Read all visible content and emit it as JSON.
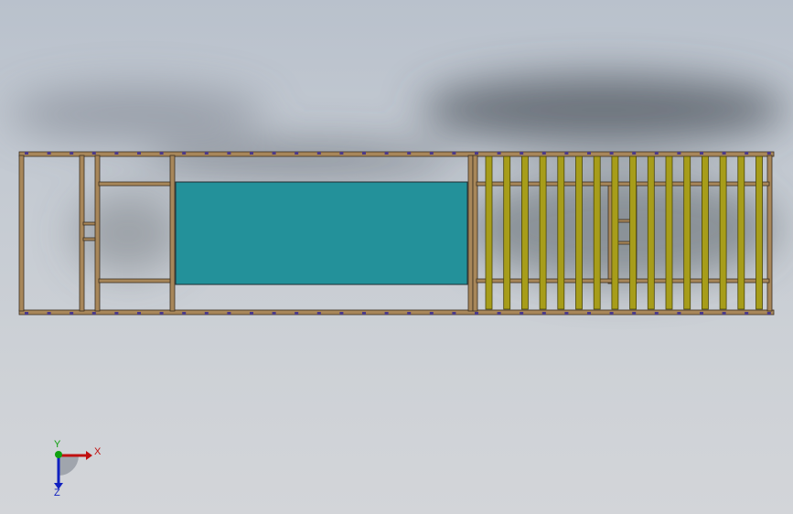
{
  "viewport": {
    "background_top": "#b9c1cc",
    "background_bottom": "#d3d5d9"
  },
  "model": {
    "frame_color": "#a8875a",
    "frame_edge_color": "#3a2e20",
    "bolt_color": "#4b3a8a",
    "panel_color": "#23919a",
    "panel_edge_color": "#1e2c30",
    "roller_color": "#a79d1a",
    "roller_edge_color": "#4a4508",
    "roller_count": 16
  },
  "triad": {
    "x_label": "X",
    "y_label": "Y",
    "z_label": "Z",
    "x_color": "#c01010",
    "y_color": "#10a010",
    "z_color": "#1020c0"
  }
}
